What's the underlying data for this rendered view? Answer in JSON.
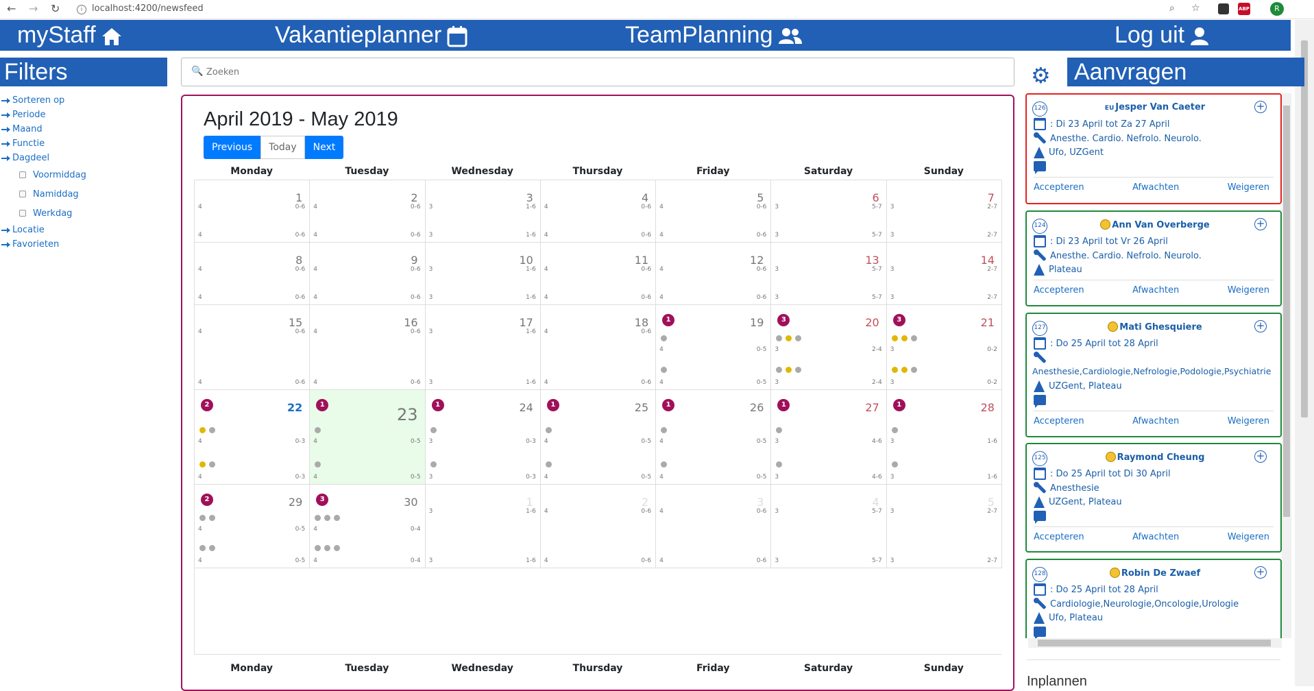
{
  "browser": {
    "url": "localhost:4200/newsfeed",
    "info_icon": "i",
    "profile_letter": "R",
    "abp_label": "ABP"
  },
  "nav": {
    "mystaff": "myStaff",
    "vakantieplanner": "Vakantieplanner",
    "teamplanning": "TeamPlanning",
    "loguit": "Log uit"
  },
  "filters": {
    "title": "Filters",
    "items": [
      "Sorteren op",
      "Periode",
      "Maand",
      "Functie",
      "Dagdeel"
    ],
    "dagdeel_options": [
      "Voormiddag",
      "Namiddag",
      "Werkdag"
    ],
    "items_after": [
      "Locatie",
      "Favorieten"
    ]
  },
  "search": {
    "placeholder": "Zoeken"
  },
  "calendar": {
    "title": "April 2019 - May 2019",
    "buttons": {
      "previous": "Previous",
      "today": "Today",
      "next": "Next"
    },
    "days": [
      "Monday",
      "Tuesday",
      "Wednesday",
      "Thursday",
      "Friday",
      "Saturday",
      "Sunday"
    ],
    "weeks": [
      {
        "days": [
          {
            "num": "1",
            "top": [
              "4",
              "0-6"
            ],
            "bot": [
              "4",
              "0-6"
            ]
          },
          {
            "num": "2",
            "top": [
              "4",
              "0-6"
            ],
            "bot": [
              "4",
              "0-6"
            ]
          },
          {
            "num": "3",
            "top": [
              "3",
              "1-6"
            ],
            "bot": [
              "3",
              "1-6"
            ]
          },
          {
            "num": "4",
            "top": [
              "4",
              "0-6"
            ],
            "bot": [
              "4",
              "0-6"
            ]
          },
          {
            "num": "5",
            "top": [
              "4",
              "0-6"
            ],
            "bot": [
              "4",
              "0-6"
            ]
          },
          {
            "num": "6",
            "top": [
              "3",
              "5-7"
            ],
            "bot": [
              "3",
              "5-7"
            ],
            "we": true
          },
          {
            "num": "7",
            "top": [
              "3",
              "2-7"
            ],
            "bot": [
              "3",
              "2-7"
            ],
            "we": true
          }
        ]
      },
      {
        "days": [
          {
            "num": "8",
            "top": [
              "4",
              "0-6"
            ],
            "bot": [
              "4",
              "0-6"
            ]
          },
          {
            "num": "9",
            "top": [
              "4",
              "0-6"
            ],
            "bot": [
              "4",
              "0-6"
            ]
          },
          {
            "num": "10",
            "top": [
              "3",
              "1-6"
            ],
            "bot": [
              "3",
              "1-6"
            ]
          },
          {
            "num": "11",
            "top": [
              "4",
              "0-6"
            ],
            "bot": [
              "4",
              "0-6"
            ]
          },
          {
            "num": "12",
            "top": [
              "4",
              "0-6"
            ],
            "bot": [
              "4",
              "0-6"
            ]
          },
          {
            "num": "13",
            "top": [
              "3",
              "5-7"
            ],
            "bot": [
              "3",
              "5-7"
            ],
            "we": true
          },
          {
            "num": "14",
            "top": [
              "3",
              "2-7"
            ],
            "bot": [
              "3",
              "2-7"
            ],
            "we": true
          }
        ]
      },
      {
        "days": [
          {
            "num": "15",
            "top": [
              "4",
              "0-6"
            ],
            "bot": [
              "4",
              "0-6"
            ]
          },
          {
            "num": "16",
            "top": [
              "4",
              "0-6"
            ],
            "bot": [
              "4",
              "0-6"
            ]
          },
          {
            "num": "17",
            "top": [
              "3",
              "1-6"
            ],
            "bot": [
              "3",
              "1-6"
            ]
          },
          {
            "num": "18",
            "top": [
              "4",
              "0-6"
            ],
            "bot": [
              "4",
              "0-6"
            ]
          },
          {
            "num": "19",
            "badge": "1",
            "dots1": [
              "g"
            ],
            "top": [
              "4",
              "0-5"
            ],
            "dots2": [
              "g"
            ],
            "bot": [
              "4",
              "0-5"
            ]
          },
          {
            "num": "20",
            "badge": "3",
            "dots1": [
              "g",
              "y",
              "g"
            ],
            "top": [
              "3",
              "2-4"
            ],
            "dots2": [
              "g",
              "y",
              "g"
            ],
            "bot": [
              "3",
              "2-4"
            ],
            "we": true
          },
          {
            "num": "21",
            "badge": "3",
            "dots1": [
              "y",
              "y",
              "g"
            ],
            "top": [
              "3",
              "0-2"
            ],
            "dots2": [
              "y",
              "y",
              "g"
            ],
            "bot": [
              "3",
              "0-2"
            ],
            "we": true
          }
        ]
      },
      {
        "days": [
          {
            "num": "22",
            "badge": "2",
            "dots1": [
              "y",
              "g"
            ],
            "top": [
              "4",
              "0-3"
            ],
            "dots2": [
              "y",
              "g"
            ],
            "bot": [
              "4",
              "0-3"
            ],
            "cur": true
          },
          {
            "num": "23",
            "badge": "1",
            "dots1": [
              "g"
            ],
            "top": [
              "4",
              "0-5"
            ],
            "dots2": [
              "g"
            ],
            "bot": [
              "4",
              "0-5"
            ],
            "today": true
          },
          {
            "num": "24",
            "badge": "1",
            "dots1": [
              "g"
            ],
            "top": [
              "3",
              "0-3"
            ],
            "dots2": [
              "g"
            ],
            "bot": [
              "3",
              "0-3"
            ]
          },
          {
            "num": "25",
            "badge": "1",
            "dots1": [
              "g"
            ],
            "top": [
              "4",
              "0-5"
            ],
            "dots2": [
              "g"
            ],
            "bot": [
              "4",
              "0-5"
            ]
          },
          {
            "num": "26",
            "badge": "1",
            "dots1": [
              "g"
            ],
            "top": [
              "4",
              "0-5"
            ],
            "dots2": [
              "g"
            ],
            "bot": [
              "4",
              "0-5"
            ]
          },
          {
            "num": "27",
            "badge": "1",
            "dots1": [
              "g"
            ],
            "top": [
              "3",
              "4-6"
            ],
            "dots2": [
              "g"
            ],
            "bot": [
              "3",
              "4-6"
            ],
            "we": true
          },
          {
            "num": "28",
            "badge": "1",
            "dots1": [
              "g"
            ],
            "top": [
              "3",
              "1-6"
            ],
            "dots2": [
              "g"
            ],
            "bot": [
              "3",
              "1-6"
            ],
            "we": true
          }
        ]
      },
      {
        "days": [
          {
            "num": "29",
            "badge": "2",
            "dots1": [
              "g",
              "g"
            ],
            "top": [
              "4",
              "0-5"
            ],
            "dots2": [
              "g",
              "g"
            ],
            "bot": [
              "4",
              "0-5"
            ]
          },
          {
            "num": "30",
            "badge": "3",
            "dots1": [
              "g",
              "g",
              "g"
            ],
            "top": [
              "4",
              "0-4"
            ],
            "dots2": [
              "g",
              "g",
              "g"
            ],
            "bot": [
              "4",
              "0-4"
            ]
          },
          {
            "num": "1",
            "top": [
              "3",
              "1-6"
            ],
            "bot": [
              "3",
              "1-6"
            ],
            "dim": true
          },
          {
            "num": "2",
            "top": [
              "4",
              "0-6"
            ],
            "bot": [
              "4",
              "0-6"
            ],
            "dim": true
          },
          {
            "num": "3",
            "top": [
              "4",
              "0-6"
            ],
            "bot": [
              "4",
              "0-6"
            ],
            "dim": true
          },
          {
            "num": "4",
            "top": [
              "3",
              "5-7"
            ],
            "bot": [
              "3",
              "5-7"
            ],
            "dim": true
          },
          {
            "num": "5",
            "top": [
              "3",
              "2-7"
            ],
            "bot": [
              "3",
              "2-7"
            ],
            "dim": true
          }
        ]
      }
    ]
  },
  "aanvragen": {
    "title": "Aanvragen",
    "accept": "Accepteren",
    "wait": "Afwachten",
    "refuse": "Weigeren",
    "requests": [
      {
        "num": "126",
        "prefix": "EU",
        "name": "Jesper Van Caeter",
        "dates": ": Di 23 April tot Za 27 April",
        "functions": "Anesthe. Cardio. Nefrolo. Neurolo.",
        "location": "Ufo, UZGent",
        "border": "red",
        "emoji": false
      },
      {
        "num": "124",
        "prefix": "",
        "name": "Ann Van Overberge",
        "dates": ": Di 23 April tot Vr 26 April",
        "functions": "Anesthe. Cardio. Nefrolo. Neurolo.",
        "location": "Plateau",
        "border": "green",
        "emoji": true
      },
      {
        "num": "127",
        "prefix": "",
        "name": "Mati Ghesquiere",
        "dates": ": Do 25 April tot 28 April",
        "functions": "Anesthesie,Cardiologie,Nefrologie,Podologie,Psychiatrie",
        "location": "UZGent, Plateau",
        "border": "green",
        "emoji": true
      },
      {
        "num": "125",
        "prefix": "",
        "name": "Raymond Cheung",
        "dates": ": Do 25 April tot Di 30 April",
        "functions": "Anesthesie",
        "location": "UZGent, Plateau",
        "border": "green",
        "emoji": true
      },
      {
        "num": "128",
        "prefix": "",
        "name": "Robin De Zwaef",
        "dates": ": Do 25 April tot 28 April",
        "functions": "Cardiologie,Neurologie,Oncologie,Urologie",
        "location": "Ufo, Plateau",
        "border": "green",
        "emoji": true
      }
    ]
  },
  "inplannen": {
    "title": "Inplannen"
  }
}
